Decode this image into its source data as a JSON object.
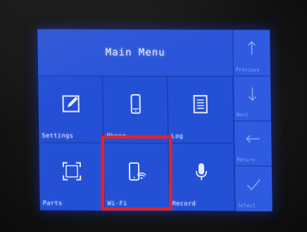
{
  "menu": {
    "title": "Main Menu",
    "tiles": [
      {
        "label": "Settings",
        "icon": "edit-icon"
      },
      {
        "label": "Phone",
        "icon": "phone-icon"
      },
      {
        "label": "Log",
        "icon": "list-icon"
      },
      {
        "label": "Parts",
        "icon": "frame-icon"
      },
      {
        "label": "Wi-Fi",
        "icon": "phone-wifi-icon"
      },
      {
        "label": "Record",
        "icon": "microphone-icon"
      }
    ]
  },
  "side_buttons": [
    {
      "label": "Previous",
      "icon": "arrow-up-icon"
    },
    {
      "label": "Next",
      "icon": "arrow-down-icon"
    },
    {
      "label": "Return",
      "icon": "arrow-left-icon"
    },
    {
      "label": "Select",
      "icon": "check-icon"
    }
  ],
  "selected_item": "Wi-Fi",
  "colors": {
    "screen_blue": "#1a3fc0",
    "tile_blue": "#2450d6",
    "highlight_red": "#e52222"
  }
}
